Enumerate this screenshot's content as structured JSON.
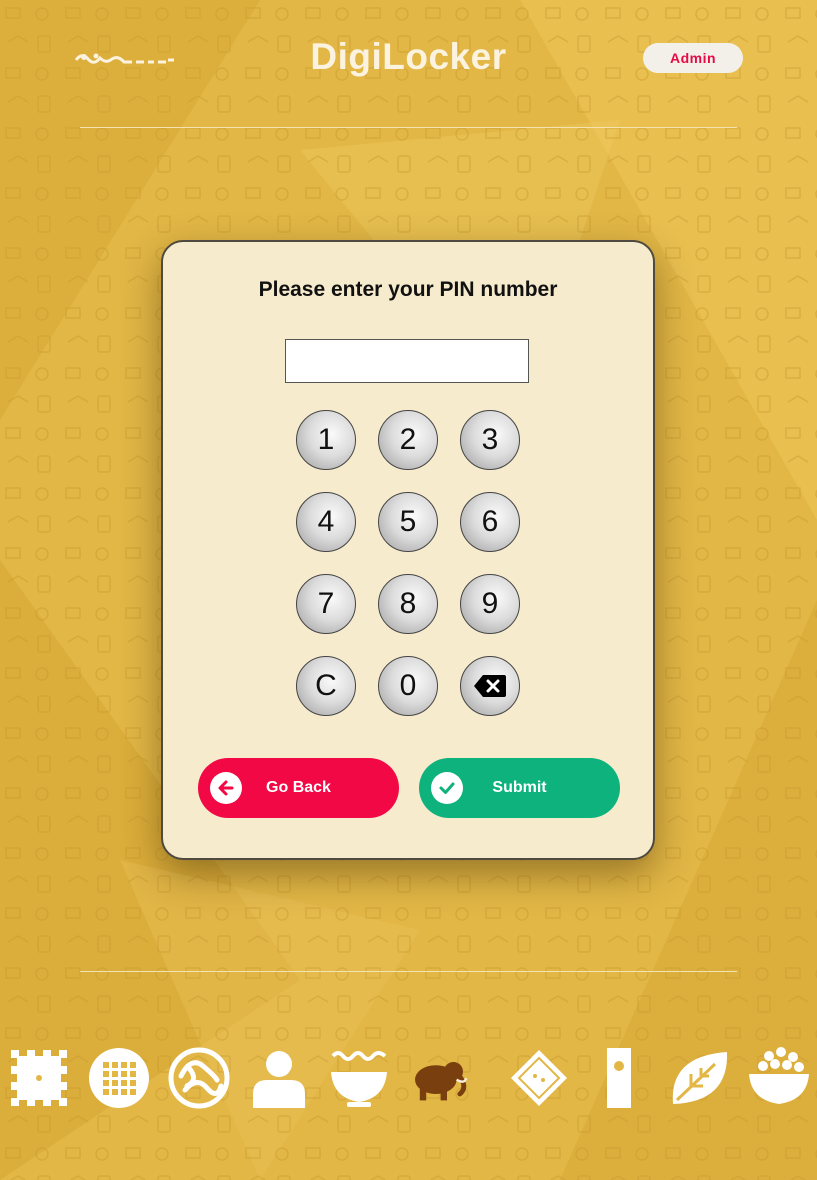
{
  "header": {
    "app_title": "DigiLocker",
    "admin_label": "Admin"
  },
  "pin_dialog": {
    "prompt": "Please enter your PIN number",
    "pin_value": "",
    "keys": [
      "1",
      "2",
      "3",
      "4",
      "5",
      "6",
      "7",
      "8",
      "9",
      "C",
      "0"
    ],
    "backspace_icon": "backspace-icon",
    "go_back_label": "Go Back",
    "submit_label": "Submit"
  },
  "footer": {
    "icons": [
      "cracker-icon",
      "waffle-icon",
      "noodles-icon",
      "person-icon",
      "soup-bowl-icon",
      "mammoth-icon",
      "biscuit-icon",
      "snack-bar-icon",
      "leaf-icon",
      "rice-bowl-icon"
    ]
  },
  "colors": {
    "background": "#e3b845",
    "go_back": "#f10845",
    "submit": "#0db27d",
    "admin_text": "#e60b47"
  }
}
